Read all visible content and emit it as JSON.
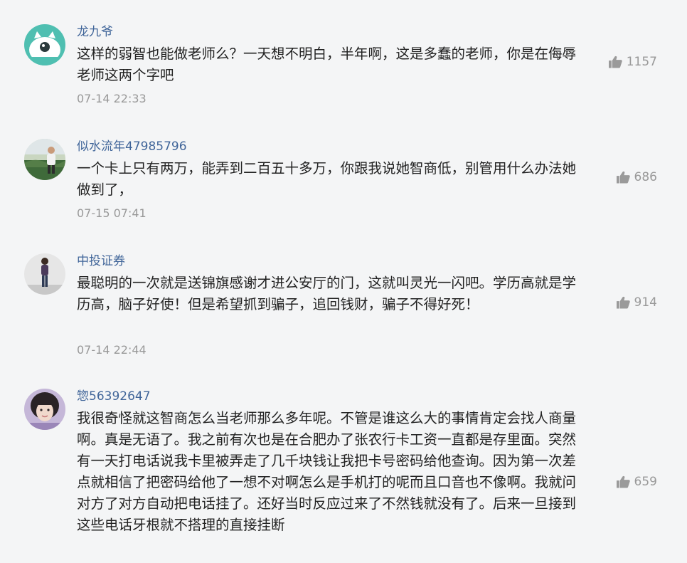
{
  "comments": [
    {
      "user": "龙九爷",
      "text": "这样的弱智也能做老师么？一天想不明白，半年啊，这是多蠢的老师，你是在侮辱老师这两个字吧",
      "time": "07-14 22:33",
      "likes": "1157",
      "avatar": "teal-cartoon-avatar"
    },
    {
      "user": "似水流年47985796",
      "text": "一个卡上只有两万，能弄到二百五十多万，你跟我说她智商低，别管用什么办法她做到了，",
      "time": "07-15 07:41",
      "likes": "686",
      "avatar": "photo-avatar"
    },
    {
      "user": "中投证券",
      "text": "最聪明的一次就是送锦旗感谢才进公安厅的门，这就叫灵光一闪吧。学历高就是学历高，脑子好使！但是希望抓到骗子，追回钱财，骗子不得好死！",
      "time": "07-14 22:44",
      "likes": "914",
      "avatar": "photo-avatar"
    },
    {
      "user": "惣56392647",
      "text": "我很奇怪就这智商怎么当老师那么多年呢。不管是谁这么大的事情肯定会找人商量啊。真是无语了。我之前有次也是在合肥办了张农行卡工资一直都是存里面。突然有一天打电话说我卡里被弄走了几千块钱让我把卡号密码给他查询。因为第一次差点就相信了把密码给他了一想不对啊怎么是手机打的呢而且口音也不像啊。我就问对方了对方自动把电话挂了。还好当时反应过来了不然钱就没有了。后来一旦接到这些电话牙根就不搭理的直接挂断",
      "time": "",
      "likes": "659",
      "avatar": "photo-avatar"
    }
  ],
  "colors": {
    "background": "#f4f5f6",
    "username": "#406599",
    "text": "#222222",
    "meta": "#999999"
  },
  "icons": {
    "like": "thumbs-up-icon"
  }
}
